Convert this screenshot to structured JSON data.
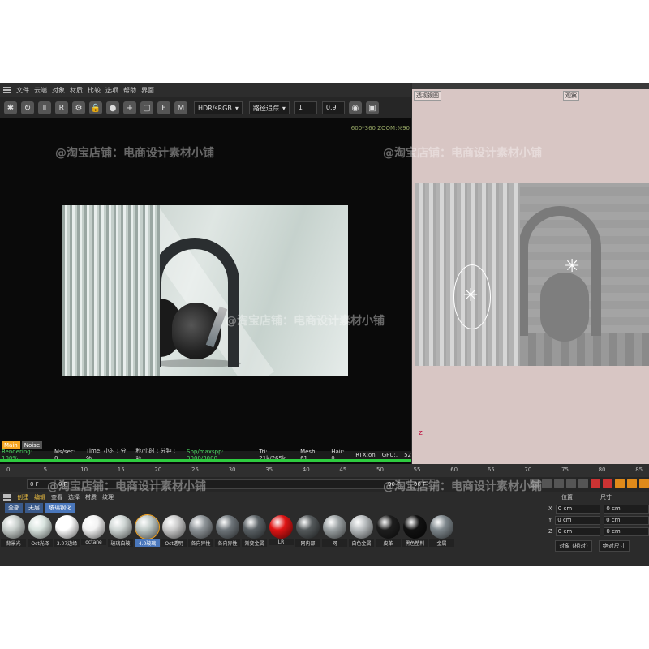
{
  "menubar": {
    "items": [
      "文件",
      "云端",
      "对象",
      "材质",
      "比较",
      "选项",
      "帮助",
      "界面"
    ]
  },
  "toolbar": {
    "color_space": "HDR/sRGB",
    "mode": "路径追踪",
    "value_a": "1",
    "value_b": "0.9"
  },
  "zoom_info": "600*360 ZOOM:%90",
  "mini_tabs": [
    "Main",
    "Noise"
  ],
  "status": {
    "rendering": "Rendering: 100%",
    "ms": "Ms/sec: 0",
    "time_label": "Time: 小时 : 分钟",
    "spp_label": "秒/小时 : 分钟 : 秒",
    "spp": "Spp/maxspp: 3000/3000",
    "tri": "Tri: 21k/265k",
    "mesh": "Mesh: 61",
    "hair": "Hair: 0",
    "rtx": "RTX:on",
    "gpu": "GPU:.",
    "num": "52",
    "progress": 1.0
  },
  "viewport": {
    "label": "透视视图",
    "camera": "观察"
  },
  "axis_label": "Z",
  "timeline": {
    "ticks": [
      "0",
      "5",
      "10",
      "15",
      "20",
      "25",
      "30",
      "35",
      "40",
      "45",
      "50",
      "55",
      "60",
      "65",
      "70",
      "75",
      "80",
      "85"
    ],
    "frame_start": "0 F",
    "frame_current": "0 F",
    "frame_end": "90 F",
    "frame_end2": "90 F"
  },
  "material_manager": {
    "menu": [
      "创建",
      "编辑",
      "查看",
      "选择",
      "材质",
      "纹理"
    ],
    "tabs": [
      "全部",
      "无层",
      "玻璃钢化"
    ],
    "materials": [
      {
        "label": "背景光",
        "color": "#c8cfcc"
      },
      {
        "label": "Oct光泽",
        "color": "#d9e4df"
      },
      {
        "label": "3.07边缘",
        "color": "#ffffff"
      },
      {
        "label": "octane",
        "color": "#f2f2f2"
      },
      {
        "label": "玻璃白玻",
        "color": "#cfd6d4"
      },
      {
        "label": "4.0玻璃",
        "color": "#bfc9c6"
      },
      {
        "label": "Oct透明",
        "color": "#c9c9c9"
      },
      {
        "label": "各向异性",
        "color": "#8e9498"
      },
      {
        "label": "各向异性",
        "color": "#6f767b"
      },
      {
        "label": "渐变金属",
        "color": "#5b6266"
      },
      {
        "label": "LR",
        "color": "#e01414"
      },
      {
        "label": "网内部",
        "color": "#555a5c"
      },
      {
        "label": "网",
        "color": "#9ba1a3"
      },
      {
        "label": "白色金属",
        "color": "#b8bcbe"
      },
      {
        "label": "皮革",
        "color": "#1e1e1e"
      },
      {
        "label": "黑色塑料",
        "color": "#111111"
      },
      {
        "label": "金属",
        "color": "#7e878c"
      }
    ]
  },
  "coord_panel": {
    "head": [
      "位置",
      "尺寸"
    ],
    "rows": [
      {
        "axis": "X",
        "pos": "0 cm",
        "size": "0 cm"
      },
      {
        "axis": "Y",
        "pos": "0 cm",
        "size": "0 cm"
      },
      {
        "axis": "Z",
        "pos": "0 cm",
        "size": "0 cm"
      }
    ],
    "foot": [
      "对象 (相对)",
      "绝对尺寸"
    ]
  },
  "watermark": "@淘宝店铺：电商设计素材小铺"
}
